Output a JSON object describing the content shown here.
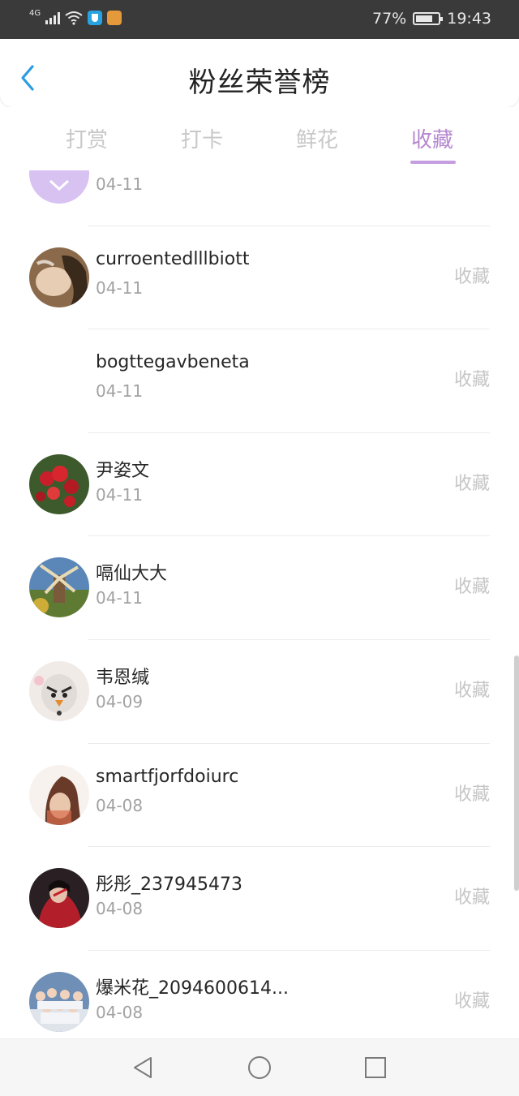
{
  "status_bar": {
    "network": "4G",
    "battery_percent": "77%",
    "battery_level": 0.77,
    "time": "19:43"
  },
  "header": {
    "back_icon": "chevron-left-icon",
    "title": "粉丝荣誉榜"
  },
  "tabs": [
    {
      "label": "打赏",
      "active": false
    },
    {
      "label": "打卡",
      "active": false
    },
    {
      "label": "鲜花",
      "active": false
    },
    {
      "label": "收藏",
      "active": true
    }
  ],
  "colors": {
    "accent": "#b688d0",
    "underline": "#c49ee0",
    "muted_text": "#a2a2a2",
    "status_bar_bg": "#3a3a3a"
  },
  "list": {
    "items": [
      {
        "name": "",
        "date": "04-11",
        "action": "",
        "avatar": "purple"
      },
      {
        "name": "curroentedlllbiott",
        "date": "04-11",
        "action": "收藏",
        "avatar": "portrait-smoke"
      },
      {
        "name": "bogttegavbeneta",
        "date": "04-11",
        "action": "收藏",
        "avatar": "none"
      },
      {
        "name": "尹姿文",
        "date": "04-11",
        "action": "收藏",
        "avatar": "berries"
      },
      {
        "name": "嗝仙大大",
        "date": "04-11",
        "action": "收藏",
        "avatar": "windmill"
      },
      {
        "name": "韦恩缄",
        "date": "04-09",
        "action": "收藏",
        "avatar": "bird-toy"
      },
      {
        "name": "smartfjorfdoiurc",
        "date": "04-08",
        "action": "收藏",
        "avatar": "girl-hair"
      },
      {
        "name": "彤彤_237945473",
        "date": "04-08",
        "action": "收藏",
        "avatar": "girl-red"
      },
      {
        "name": "爆米花_2094600614...",
        "date": "04-08",
        "action": "收藏",
        "avatar": "group-photo"
      }
    ]
  },
  "nav_bar": {
    "back_icon": "triangle-back-icon",
    "home_icon": "circle-home-icon",
    "recents_icon": "square-recents-icon"
  }
}
